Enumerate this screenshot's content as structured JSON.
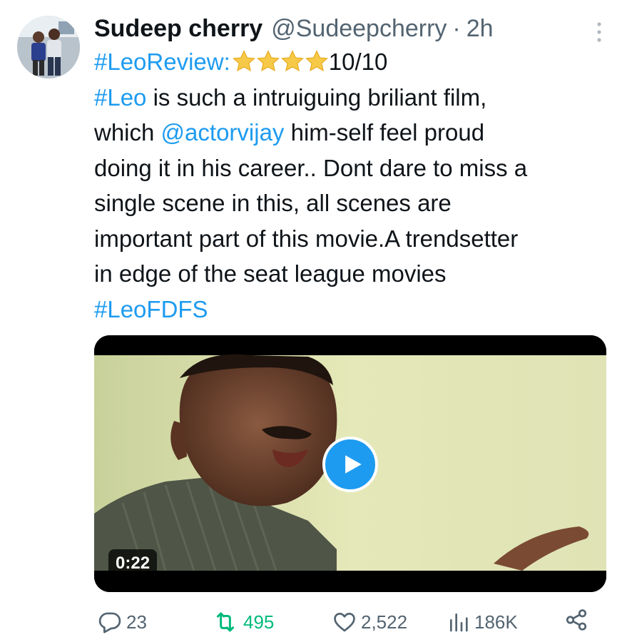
{
  "tweet": {
    "author": {
      "display_name": "Sudeep cherry",
      "handle": "@Sudeepcherry",
      "separator": "·",
      "time": "2h"
    },
    "text": {
      "line1_hashtag": "#LeoReview:",
      "line1_rating": "10/10",
      "star_count": 4,
      "line2_hashtag": "#Leo",
      "line2_rest": " is such a intruiguing briliant film,",
      "line3_start": "which ",
      "line3_mention": "@actorvijay",
      "line3_rest": " him-self feel proud",
      "line4": "doing it in his career.. Dont dare to miss a",
      "line5": "single scene in this, all scenes are",
      "line6": "important part of this movie.A trendsetter",
      "line7": "in edge of the seat league movies",
      "line8_hashtag": "#LeoFDFS"
    },
    "media": {
      "duration": "0:22"
    },
    "actions": {
      "replies": "23",
      "retweets": "495",
      "likes": "2,522",
      "views": "186K"
    }
  },
  "colors": {
    "link": "#1d9bf0",
    "text": "#0f1419",
    "secondary": "#536471",
    "retweet_active": "#00ba7c",
    "star": "#f7c948"
  },
  "icons": {
    "more": "more-vertical-icon",
    "star": "star-icon",
    "play": "play-icon",
    "reply": "reply-bubble-icon",
    "retweet": "retweet-icon",
    "like": "heart-icon",
    "views": "views-bar-chart-icon",
    "share": "share-icon"
  }
}
